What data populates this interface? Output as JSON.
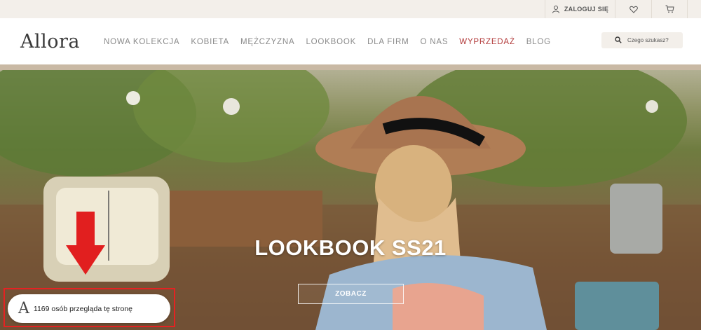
{
  "topbar": {
    "login_label": "ZALOGUJ SIĘ",
    "login_icon": "user-icon",
    "wishlist_icon": "heart-icon",
    "cart_icon": "cart-icon"
  },
  "header": {
    "logo": "Allora",
    "nav": [
      {
        "label": "NOWA KOLEKCJA"
      },
      {
        "label": "KOBIETA"
      },
      {
        "label": "MĘŻCZYZNA"
      },
      {
        "label": "LOOKBOOK"
      },
      {
        "label": "DLA FIRM"
      },
      {
        "label": "O NAS"
      },
      {
        "label": "WYPRZEDAŻ"
      },
      {
        "label": "BLOG"
      }
    ],
    "search_placeholder": "Czego szukasz?",
    "search_icon": "search-icon"
  },
  "hero": {
    "title": "LOOKBOOK SS21",
    "button_label": "ZOBACZ"
  },
  "popup": {
    "logo_mark": "A",
    "text": "1169 osób przegląda tę stronę"
  },
  "colors": {
    "accent_sale": "#b23a3a",
    "annotation_red": "#e52222",
    "topbar_bg": "#f3efea"
  }
}
